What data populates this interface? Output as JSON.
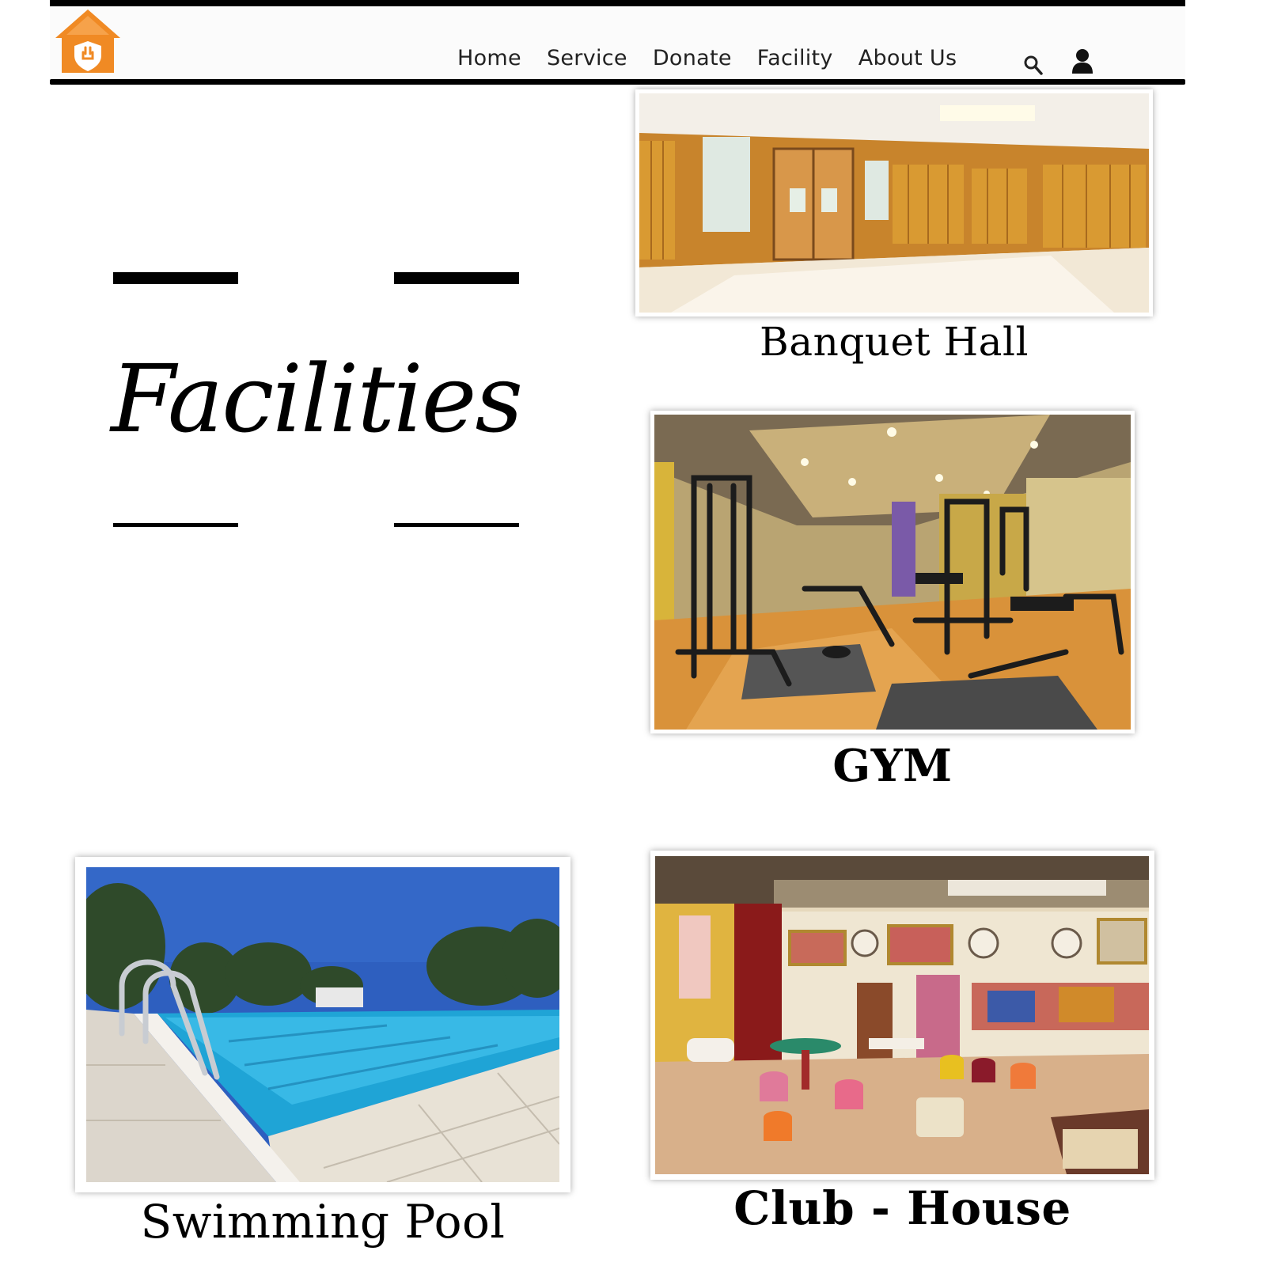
{
  "nav": {
    "links": [
      "Home",
      "Service",
      "Donate",
      "Facility",
      "About Us"
    ],
    "logo_icon": "house-shield-logo",
    "search_icon": "search-icon",
    "user_icon": "user-icon",
    "logo_color": "#F08A24"
  },
  "hero": {
    "title": "Facilities"
  },
  "facilities": [
    {
      "caption": "Banquet Hall",
      "image": "banquet-hall-photo"
    },
    {
      "caption": "GYM",
      "image": "gym-photo"
    },
    {
      "caption": "Swimming Pool",
      "image": "swimming-pool-photo"
    },
    {
      "caption": "Club - House",
      "image": "club-house-photo"
    }
  ]
}
